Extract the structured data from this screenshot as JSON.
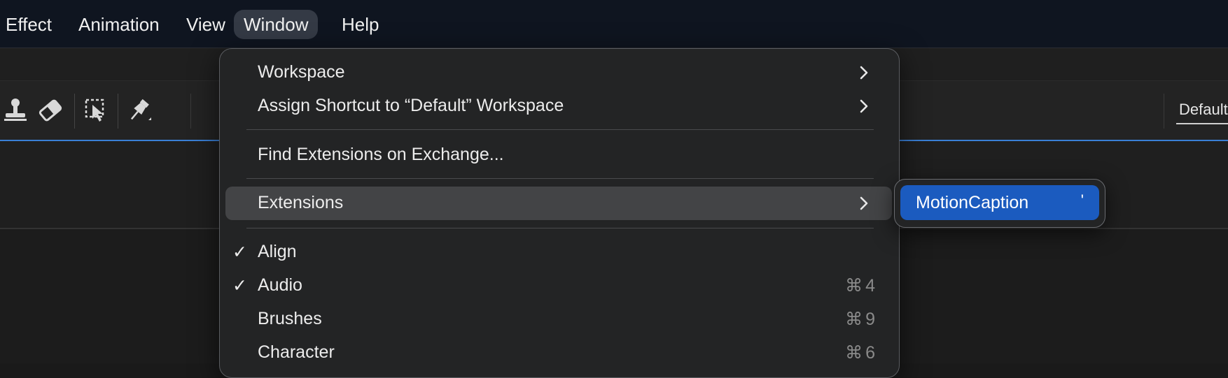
{
  "menubar": {
    "items": [
      {
        "label": "Effect"
      },
      {
        "label": "Animation"
      },
      {
        "label": "View"
      },
      {
        "label": "Window"
      },
      {
        "label": "Help"
      }
    ]
  },
  "toolbar": {
    "workspace_label": "Default",
    "icons": [
      "stamp-icon",
      "eraser-icon",
      "roto-brush-icon",
      "puppet-pin-icon"
    ]
  },
  "window_menu": {
    "items": [
      {
        "label": "Workspace",
        "submenu": true
      },
      {
        "label": "Assign Shortcut to “Default” Workspace",
        "submenu": true
      },
      {
        "label": "Find Extensions on Exchange..."
      },
      {
        "label": "Extensions",
        "submenu": true,
        "highlighted": true
      },
      {
        "label": "Align",
        "checked": true,
        "check": "✓"
      },
      {
        "label": "Audio",
        "checked": true,
        "check": "✓",
        "shortcut": "⌘4"
      },
      {
        "label": "Brushes",
        "shortcut": "⌘9"
      },
      {
        "label": "Character",
        "shortcut": "⌘6"
      }
    ]
  },
  "extensions_submenu": {
    "items": [
      {
        "label": "MotionCaption",
        "shortcut": "'"
      }
    ]
  },
  "colors": {
    "accent": "#1b5bbf",
    "menu_bg": "#232425",
    "menubar_bg": "#0f1520"
  }
}
